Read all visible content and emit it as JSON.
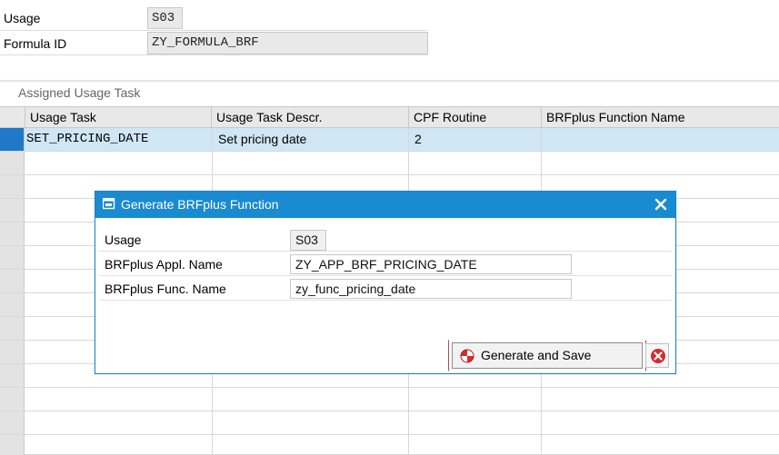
{
  "header": {
    "usage_label": "Usage",
    "usage_value": "S03",
    "formula_label": "Formula ID",
    "formula_value": "ZY_FORMULA_BRF"
  },
  "table": {
    "title": "Assigned Usage Task",
    "columns": [
      "Usage Task",
      "Usage Task Descr.",
      "CPF Routine",
      "BRFplus Function Name"
    ],
    "rows": [
      [
        "SET_PRICING_DATE",
        "Set pricing date",
        "2",
        ""
      ]
    ]
  },
  "dialog": {
    "title": "Generate BRFplus Function",
    "usage_label": "Usage",
    "usage_value": "S03",
    "appl_label": "BRFplus Appl. Name",
    "appl_value": "ZY_APP_BRF_PRICING_DATE",
    "func_label": "BRFplus Func. Name",
    "func_value": "zy_func_pricing_date",
    "generate_label": "Generate and Save",
    "close_icon": "close-icon",
    "cancel_icon": "cancel-icon"
  },
  "colors": {
    "dialog_title_bg": "#1a8ad1",
    "selected_row": "#cfe6f5",
    "row_marker": "#1f78c8"
  }
}
